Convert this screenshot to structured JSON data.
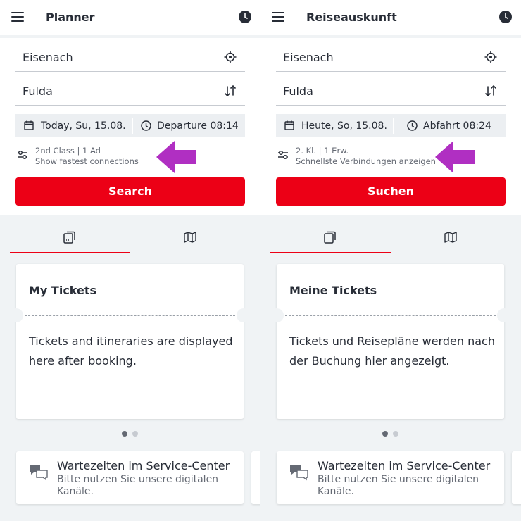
{
  "colors": {
    "accent": "#ec0016",
    "arrow": "#b02fc2",
    "text": "#282d37"
  },
  "panels": [
    {
      "app_title": "Planner",
      "from": "Eisenach",
      "to": "Fulda",
      "date": "Today, Su, 15.08.",
      "departure": "Departure 08:14",
      "options_line1": "2nd Class | 1 Ad",
      "options_line2": "Show fastest connections",
      "search_label": "Search",
      "card_title": "My Tickets",
      "card_body": "Tickets and itineraries are displayed here after booking.",
      "info_title": "Wartezeiten im Service-Center",
      "info_body": "Bitte nutzen Sie unsere digitalen Kanäle."
    },
    {
      "app_title": "Reiseauskunft",
      "from": "Eisenach",
      "to": "Fulda",
      "date": "Heute, So, 15.08.",
      "departure": "Abfahrt 08:24",
      "options_line1": "2. Kl. | 1 Erw.",
      "options_line2": "Schnellste Verbindungen anzeigen",
      "search_label": "Suchen",
      "card_title": "Meine Tickets",
      "card_body": "Tickets und Reisepläne werden nach der Buchung hier angezeigt.",
      "info_title": "Wartezeiten im Service-Center",
      "info_body": "Bitte nutzen Sie unsere digitalen Kanäle."
    }
  ],
  "icons": [
    "menu-icon",
    "clock-icon",
    "location-target-icon",
    "swap-icon",
    "calendar-icon",
    "filter-sliders-icon",
    "ticket-tab-icon",
    "map-tab-icon",
    "chat-bubbles-icon",
    "highlight-arrow-icon"
  ]
}
